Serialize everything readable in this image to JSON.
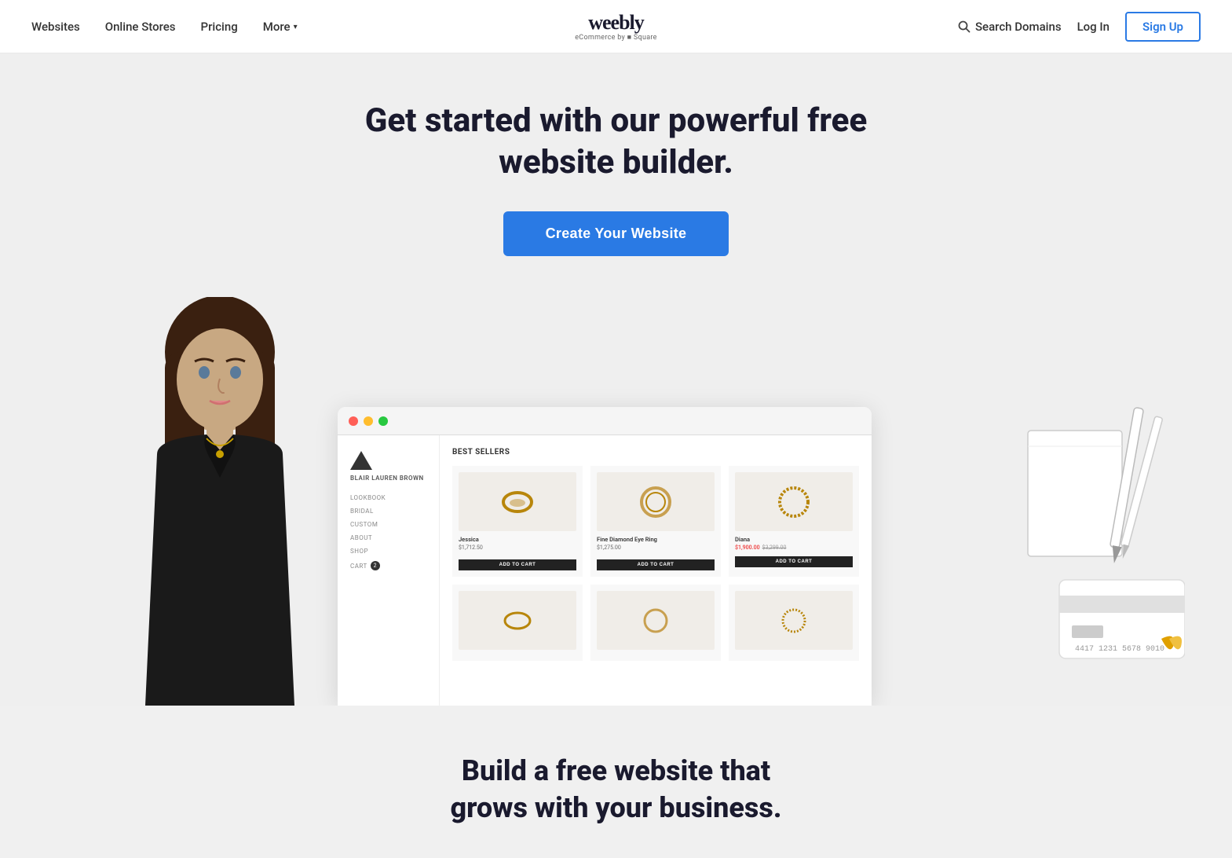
{
  "nav": {
    "links": [
      {
        "label": "Websites",
        "id": "websites"
      },
      {
        "label": "Online Stores",
        "id": "online-stores"
      },
      {
        "label": "Pricing",
        "id": "pricing"
      },
      {
        "label": "More",
        "id": "more"
      }
    ],
    "logo": {
      "text": "weebly",
      "sub": "eCommerce by ■ Square"
    },
    "search_domains": "Search Domains",
    "login": "Log In",
    "signup": "Sign Up"
  },
  "hero": {
    "headline_line1": "Get started with our powerful free",
    "headline_line2": "website builder.",
    "cta": "Create Your Website"
  },
  "browser": {
    "section_title": "BEST SELLERS",
    "brand_name": "BLAIR LAUREN BROWN",
    "nav_items": [
      "LOOKBOOK",
      "BRIDAL",
      "CUSTOM",
      "ABOUT",
      "SHOP"
    ],
    "cart_label": "CART",
    "cart_count": "2",
    "products": [
      {
        "name": "Jessica",
        "price": "$1,712.50",
        "sale_price": null,
        "orig_price": null,
        "add_label": "ADD TO CART",
        "ring": "💍"
      },
      {
        "name": "Fine Diamond Eye Ring",
        "price": "$1,275.00",
        "sale_price": null,
        "orig_price": null,
        "add_label": "ADD TO CART",
        "ring": "💍"
      },
      {
        "name": "Diana",
        "price": null,
        "sale_price": "$1,900.00",
        "orig_price": "$3,299.00",
        "add_label": "ADD TO CART",
        "ring": "💍"
      }
    ]
  },
  "bottom": {
    "headline_line1": "Build a free website that",
    "headline_line2": "grows with your business."
  }
}
